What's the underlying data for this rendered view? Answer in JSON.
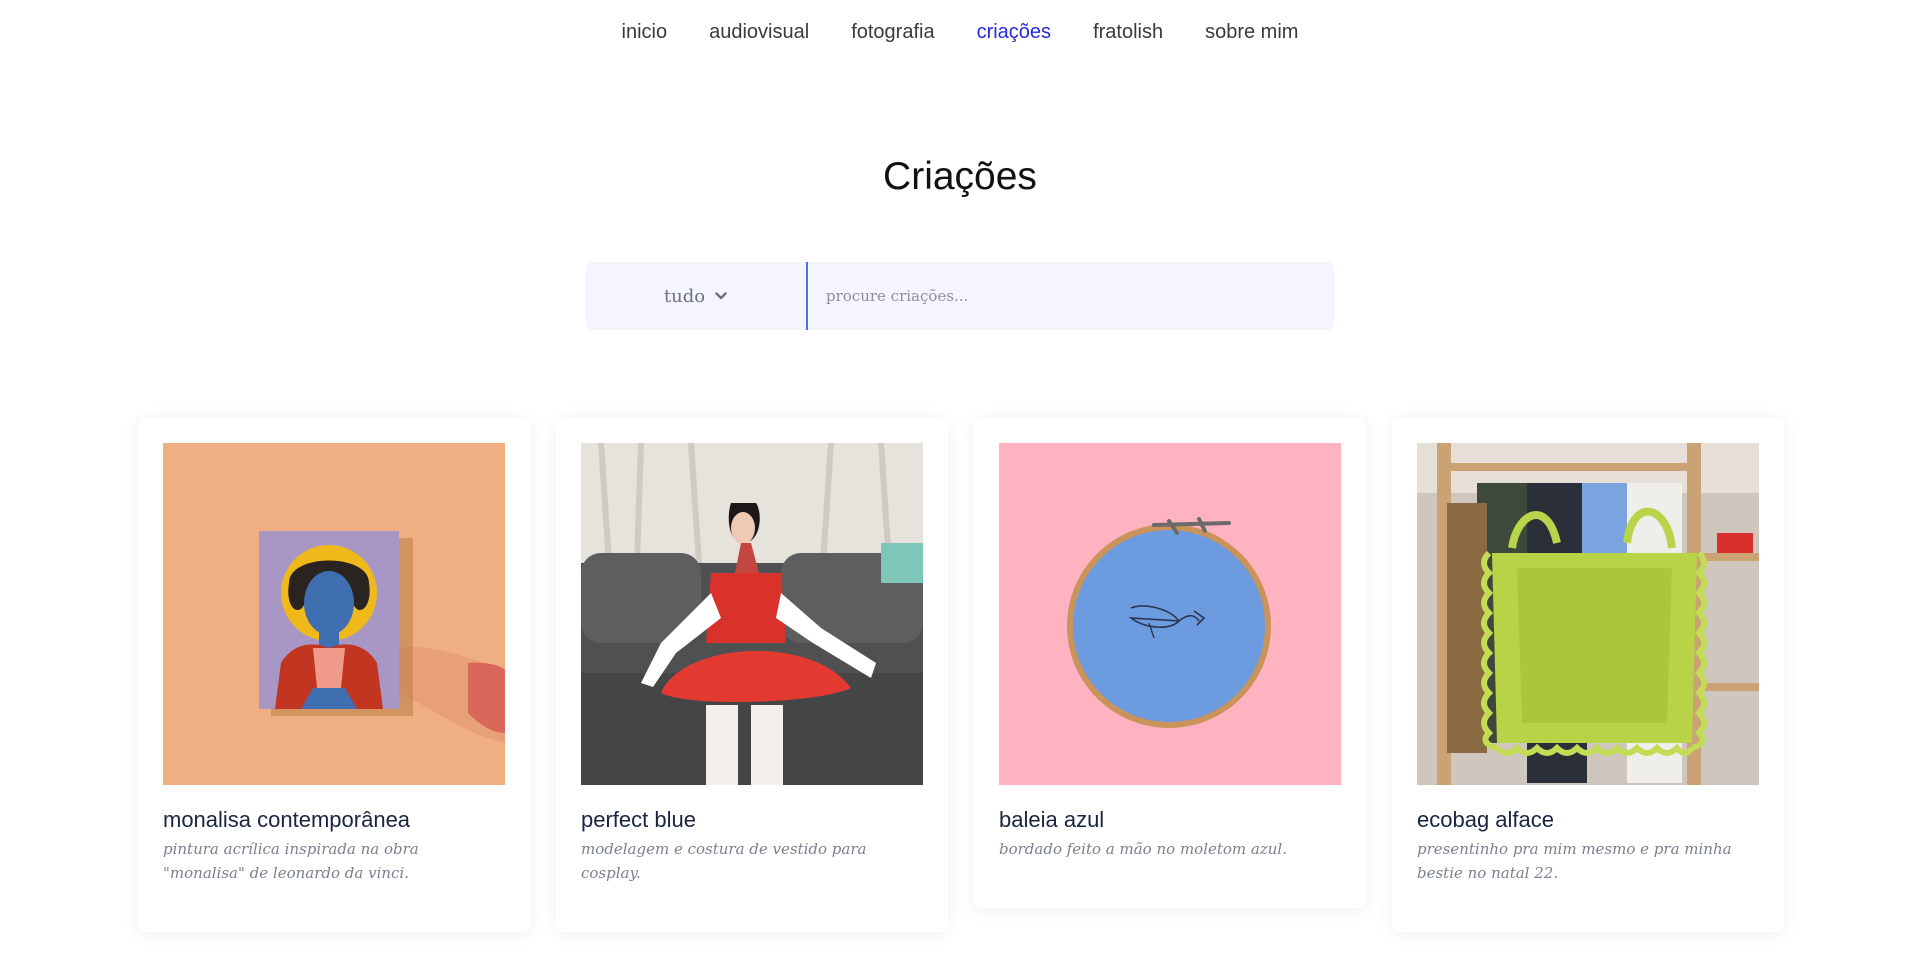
{
  "nav": {
    "items": [
      {
        "label": "inicio"
      },
      {
        "label": "audiovisual"
      },
      {
        "label": "fotografia"
      },
      {
        "label": "criações"
      },
      {
        "label": "fratolish"
      },
      {
        "label": "sobre mim"
      }
    ],
    "active_index": 3,
    "active_color": "#2a2ad6"
  },
  "page": {
    "title": "Criações"
  },
  "search": {
    "filter_label": "tudo",
    "filter_icon": "chevron-down-icon",
    "placeholder": "procure criações...",
    "value": ""
  },
  "cards": [
    {
      "title": "monalisa contemporânea",
      "description": "pintura acrílica inspirada na obra \"monalisa\" de leonardo da vinci."
    },
    {
      "title": "perfect blue",
      "description": "modelagem e costura de vestido para cosplay."
    },
    {
      "title": "baleia azul",
      "description": "bordado feito a mão no moletom azul."
    },
    {
      "title": "ecobag alface",
      "description": "presentinho pra mim mesmo e pra minha bestie no natal 22."
    }
  ]
}
